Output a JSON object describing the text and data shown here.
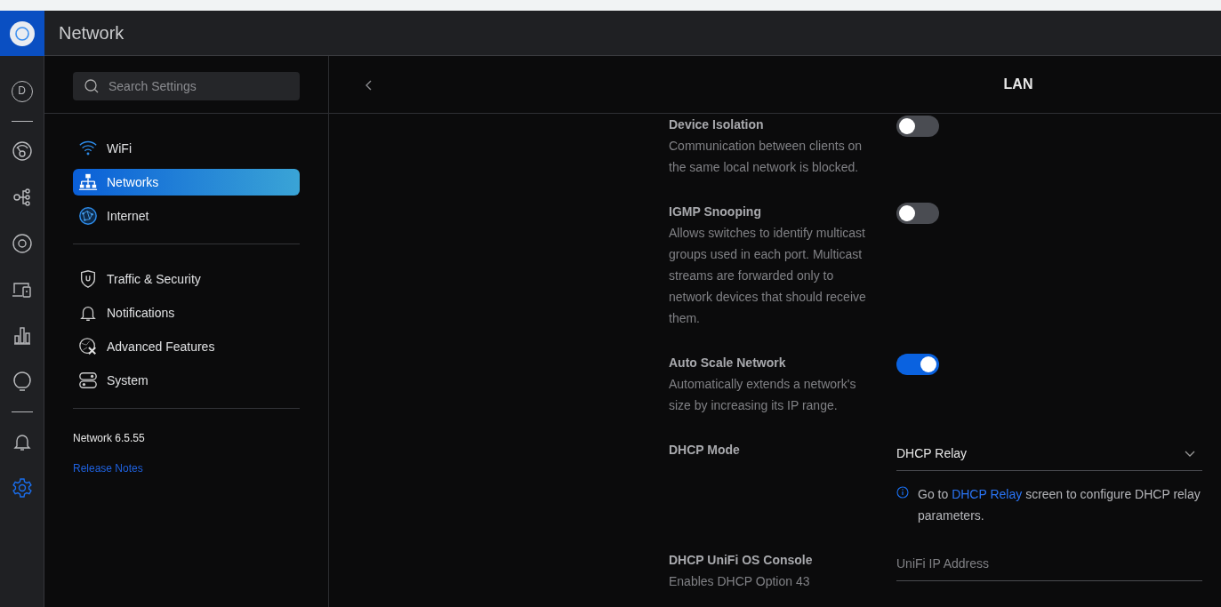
{
  "app": {
    "title": "Network"
  },
  "rail": [
    {
      "kind": "dashboard",
      "letter": "D",
      "selected": false
    },
    {
      "kind": "divider"
    },
    {
      "kind": "gauge",
      "selected": false
    },
    {
      "kind": "topology",
      "selected": false
    },
    {
      "kind": "target",
      "selected": false
    },
    {
      "kind": "devices",
      "selected": false
    },
    {
      "kind": "stats",
      "selected": false
    },
    {
      "kind": "bulb",
      "selected": false
    },
    {
      "kind": "divider"
    },
    {
      "kind": "bell",
      "selected": false
    },
    {
      "kind": "gear",
      "selected": true
    }
  ],
  "sidebar": {
    "search": {
      "placeholder": "Search Settings"
    },
    "groups": [
      [
        {
          "kind": "wifi",
          "label": "WiFi",
          "selected": false
        },
        {
          "kind": "networks",
          "label": "Networks",
          "selected": true
        },
        {
          "kind": "globe",
          "label": "Internet",
          "selected": false
        }
      ],
      [
        {
          "kind": "shield",
          "label": "Traffic & Security",
          "selected": false
        },
        {
          "kind": "bell",
          "label": "Notifications",
          "selected": false
        },
        {
          "kind": "tools",
          "label": "Advanced Features",
          "selected": false
        },
        {
          "kind": "system",
          "label": "System",
          "selected": false
        }
      ]
    ],
    "version": "Network 6.5.55",
    "release_notes": "Release Notes"
  },
  "main": {
    "title": "LAN",
    "settings": [
      {
        "kind": "toggle",
        "label": "Device Isolation",
        "description": "Communication between clients on the same local network is blocked.",
        "on": false
      },
      {
        "kind": "toggle",
        "label": "IGMP Snooping",
        "description": "Allows switches to identify multicast groups used in each port. Multicast streams are forwarded only to network devices that should receive them.",
        "on": false
      },
      {
        "kind": "toggle",
        "label": "Auto Scale Network",
        "description": "Automatically extends a network's size by increasing its IP range.",
        "on": true
      },
      {
        "kind": "select",
        "label": "DHCP Mode",
        "value": "DHCP Relay",
        "note": {
          "before": "Go to",
          "link": "DHCP Relay",
          "after": "screen to configure DHCP relay parameters."
        }
      },
      {
        "kind": "input",
        "label": "DHCP UniFi OS Console",
        "placeholder": "UniFi IP Address",
        "description": "Enables DHCP Option 43"
      }
    ]
  }
}
